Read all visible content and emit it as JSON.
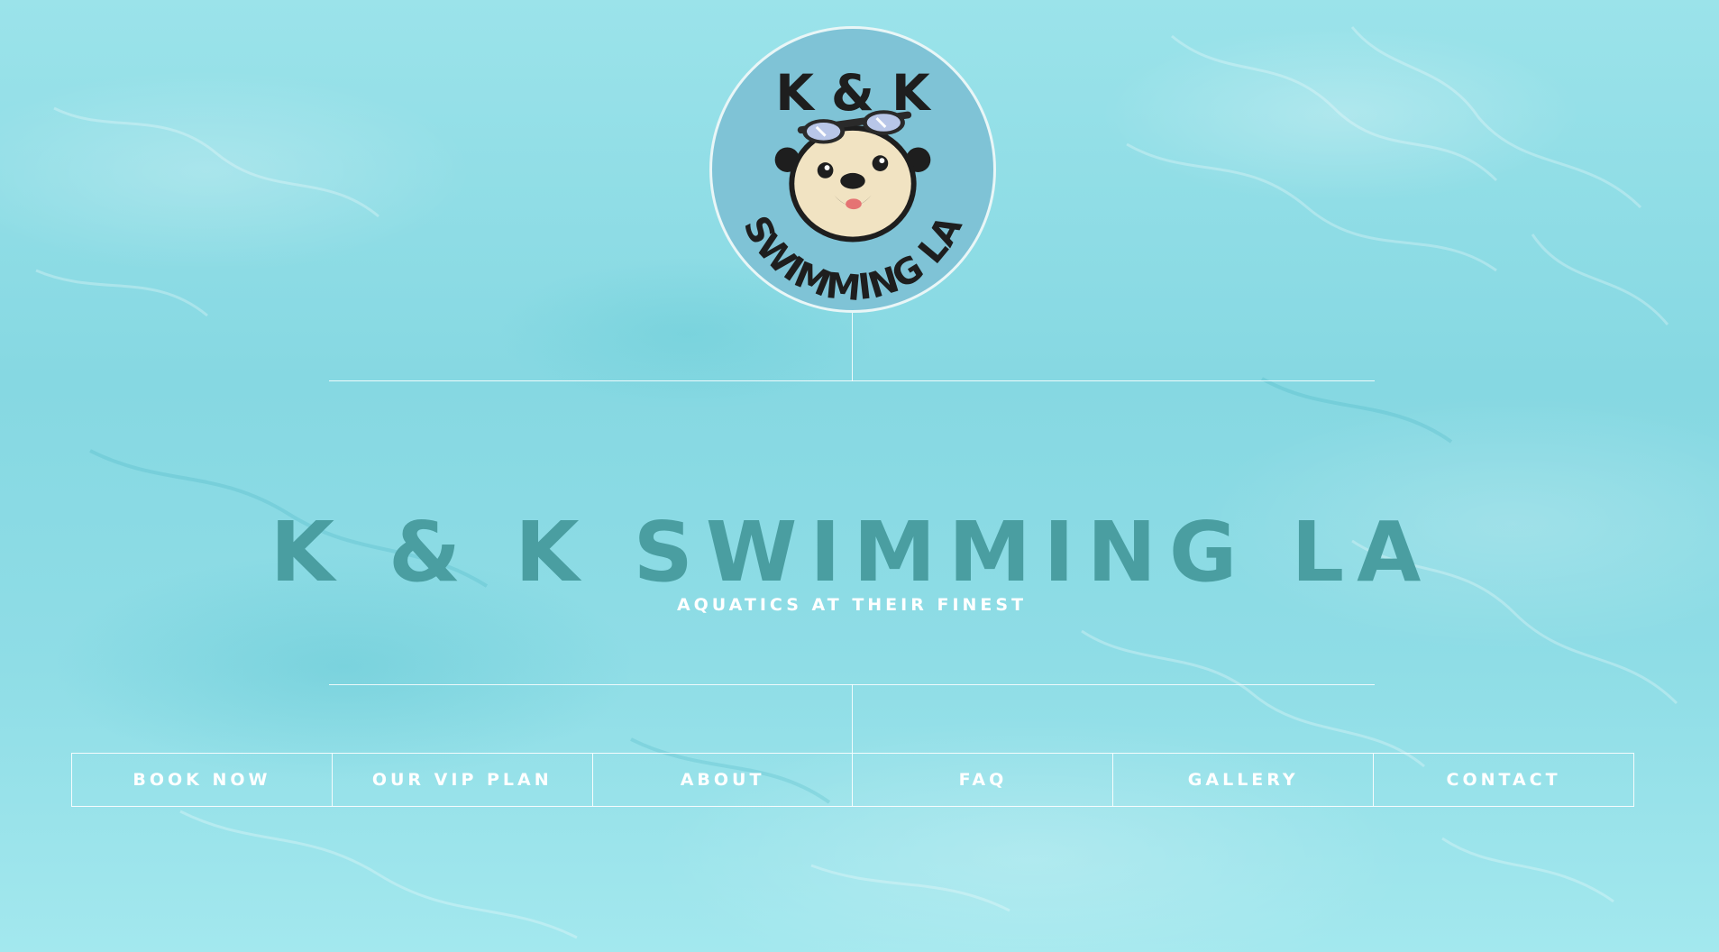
{
  "site": {
    "logo": {
      "top_text": "K & K",
      "bottom_text": "SWIMMING LA",
      "icon": "swimming-otter-logo"
    },
    "title": "K & K SWIMMING LA",
    "subtitle": "AQUATICS AT THEIR FINEST"
  },
  "nav": {
    "items": [
      {
        "label": "BOOK NOW"
      },
      {
        "label": "OUR VIP PLAN"
      },
      {
        "label": "ABOUT"
      },
      {
        "label": "FAQ"
      },
      {
        "label": "GALLERY"
      },
      {
        "label": "CONTACT"
      }
    ]
  },
  "colors": {
    "background": "#8fdde6",
    "title": "#4a9ea1",
    "nav_text": "#ffffff",
    "logo_bg": "#7fc3d6"
  }
}
